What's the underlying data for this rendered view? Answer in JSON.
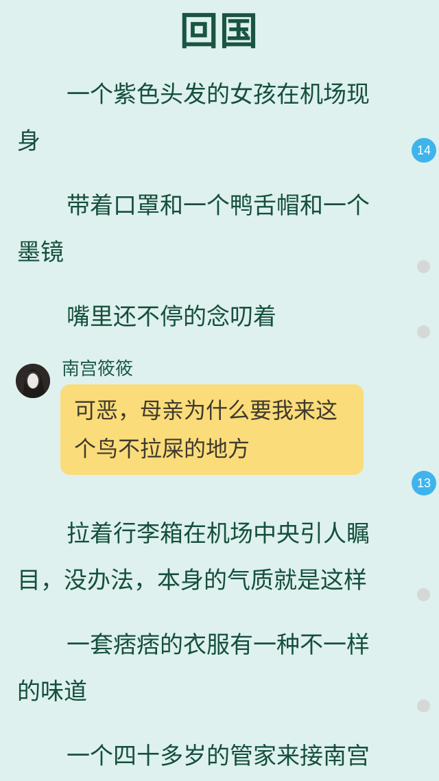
{
  "title": "回国",
  "paragraphs": [
    "一个紫色头发的女孩在机场现身",
    "带着口罩和一个鸭舌帽和一个墨镜",
    "嘴里还不停的念叨着",
    "拉着行李箱在机场中央引人瞩目，没办法，本身的气质就是这样",
    "一套痞痞的衣服有一种不一样的味道",
    "一个四十多岁的管家来接南宫"
  ],
  "chat": {
    "speaker": "南宫筱筱",
    "message": "可恶，母亲为什么要我来这个鸟不拉屎的地方"
  },
  "comment_badges": [
    "14",
    "13"
  ],
  "colors": {
    "background": "#def1ee",
    "text": "#154f3c",
    "badge": "#3fb4ec",
    "bubble": "#fbdc7a",
    "dot": "#d6d8d8"
  }
}
